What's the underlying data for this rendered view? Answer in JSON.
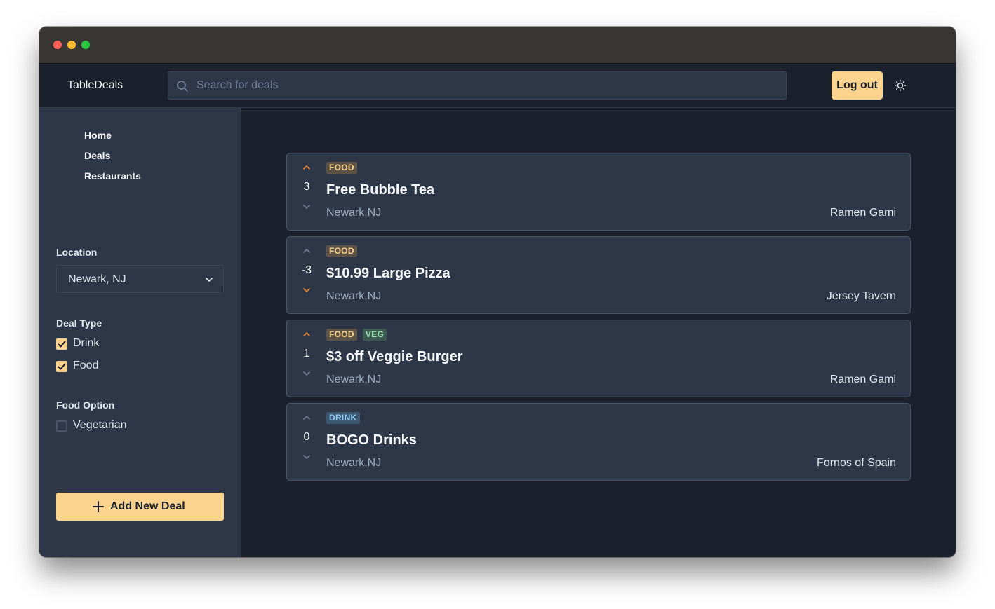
{
  "app": {
    "brand": "TableDeals",
    "search_placeholder": "Search for deals",
    "logout_label": "Log out"
  },
  "sidebar": {
    "nav": [
      {
        "label": "Home"
      },
      {
        "label": "Deals"
      },
      {
        "label": "Restaurants"
      }
    ],
    "location": {
      "label": "Location",
      "selected": "Newark, NJ"
    },
    "deal_type": {
      "label": "Deal Type",
      "options": [
        {
          "label": "Drink",
          "checked": true
        },
        {
          "label": "Food",
          "checked": true
        }
      ]
    },
    "food_option": {
      "label": "Food Option",
      "options": [
        {
          "label": "Vegetarian",
          "checked": false
        }
      ]
    },
    "add_button": "Add New Deal"
  },
  "deals": [
    {
      "tags": [
        "FOOD"
      ],
      "votes": "3",
      "title": "Free Bubble Tea",
      "location": "Newark,NJ",
      "restaurant": "Ramen Gami",
      "vote_state": "up"
    },
    {
      "tags": [
        "FOOD"
      ],
      "votes": "-3",
      "title": "$10.99 Large Pizza",
      "location": "Newark,NJ",
      "restaurant": "Jersey Tavern",
      "vote_state": "down"
    },
    {
      "tags": [
        "FOOD",
        "VEG"
      ],
      "votes": "1",
      "title": "$3 off Veggie Burger",
      "location": "Newark,NJ",
      "restaurant": "Ramen Gami",
      "vote_state": "up"
    },
    {
      "tags": [
        "DRINK"
      ],
      "votes": "0",
      "title": "BOGO Drinks",
      "location": "Newark,NJ",
      "restaurant": "Fornos of Spain",
      "vote_state": "none"
    }
  ],
  "colors": {
    "accent": "#fbd38d",
    "active_vote": "#ed8936",
    "inactive_vote": "#718096",
    "background": "#1a202c",
    "panel": "#2d3748"
  },
  "icons": {
    "search": "search-icon",
    "theme": "sun-icon",
    "select": "chevron-down-icon",
    "add": "plus-icon",
    "upvote": "chevron-up-icon",
    "downvote": "chevron-down-icon"
  }
}
